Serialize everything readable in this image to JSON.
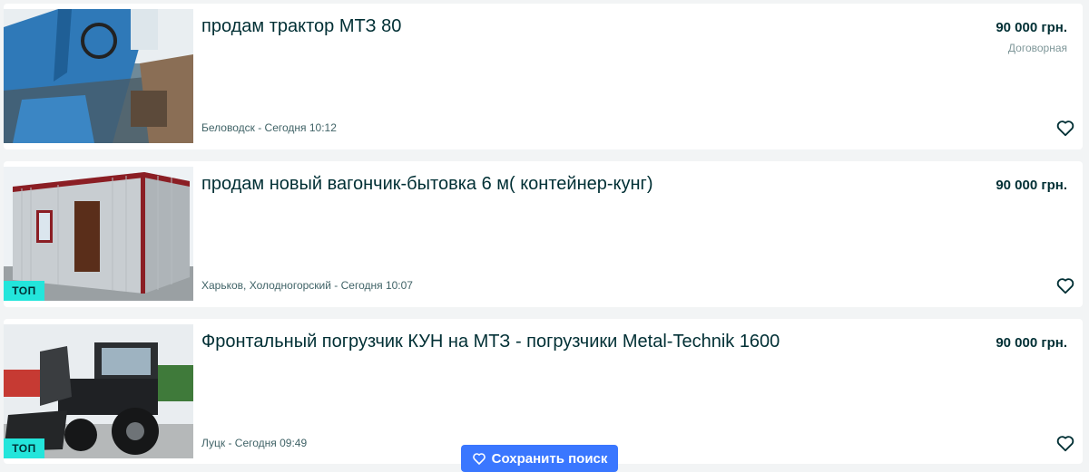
{
  "listings": [
    {
      "title": "продам трактор МТЗ 80",
      "price": "90 000 грн.",
      "price_note": "Договорная",
      "location_date": "Беловодск - Сегодня 10:12",
      "badge": ""
    },
    {
      "title": "продам новый вагончик-бытовка 6 м( контейнер-кунг)",
      "price": "90 000 грн.",
      "price_note": "",
      "location_date": "Харьков, Холодногорский - Сегодня 10:07",
      "badge": "ТОП"
    },
    {
      "title": "Фронтальный погрузчик КУН на МТЗ - погрузчики Metal-Technik 1600",
      "price": "90 000 грн.",
      "price_note": "",
      "location_date": "Луцк - Сегодня 09:49",
      "badge": "ТОП"
    }
  ],
  "save_search": {
    "label": "Сохранить поиск",
    "icon": "heart-icon"
  },
  "colors": {
    "badge": "#23e5db",
    "primary_text": "#002f34",
    "button": "#3a77ff"
  }
}
